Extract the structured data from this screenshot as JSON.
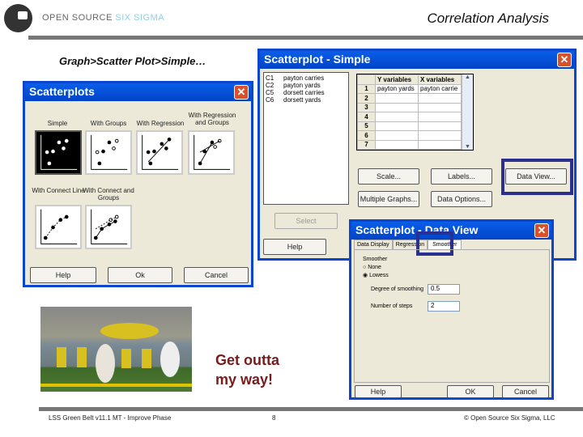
{
  "header": {
    "brand_main": "OPEN SOURCE",
    "brand_accent": "SIX SIGMA",
    "title": "Correlation Analysis",
    "menu_path": "Graph>Scatter Plot>Simple…"
  },
  "scatterplots_dialog": {
    "title": "Scatterplots",
    "options": [
      "Simple",
      "With Groups",
      "With Regression",
      "With Regression and Groups",
      "With Connect Line",
      "With Connect and Groups"
    ],
    "buttons": {
      "help": "Help",
      "ok": "Ok",
      "cancel": "Cancel"
    },
    "selected": "Simple"
  },
  "simple_dialog": {
    "title": "Scatterplot - Simple",
    "columns": [
      {
        "id": "C1",
        "name": "payton carries"
      },
      {
        "id": "C2",
        "name": "payton yards"
      },
      {
        "id": "C5",
        "name": "dorsett carries"
      },
      {
        "id": "C6",
        "name": "dorsett yards"
      }
    ],
    "grid_headers": [
      "Y variables",
      "X variables"
    ],
    "rows": [
      {
        "n": "1",
        "y": "payton yards",
        "x": "payton carrie"
      },
      {
        "n": "2",
        "y": "",
        "x": ""
      },
      {
        "n": "3",
        "y": "",
        "x": ""
      },
      {
        "n": "4",
        "y": "",
        "x": ""
      },
      {
        "n": "5",
        "y": "",
        "x": ""
      },
      {
        "n": "6",
        "y": "",
        "x": ""
      },
      {
        "n": "7",
        "y": "",
        "x": ""
      }
    ],
    "buttons": {
      "scale": "Scale...",
      "labels": "Labels...",
      "data_view": "Data View...",
      "multiple_graphs": "Multiple Graphs...",
      "data_options": "Data Options...",
      "select": "Select",
      "help": "Help"
    }
  },
  "data_view_dialog": {
    "title": "Scatterplot - Data View",
    "tabs": [
      "Data Display",
      "Regression",
      "Smoother"
    ],
    "active_tab": "Smoother",
    "group_label": "Smoother",
    "radios": [
      {
        "label": "None",
        "checked": false
      },
      {
        "label": "Lowess",
        "checked": true
      }
    ],
    "fields": [
      {
        "label": "Degree of smoothing",
        "value": "0.5"
      },
      {
        "label": "Number of steps",
        "value": "2"
      }
    ],
    "buttons": {
      "help": "Help",
      "ok": "OK",
      "cancel": "Cancel"
    }
  },
  "callout": {
    "line1": "Get outta",
    "line2": "my way!"
  },
  "footer": {
    "left": "LSS Green Belt v11.1 MT - Improve Phase",
    "page": "8",
    "right": "© Open Source Six Sigma, LLC"
  },
  "colors": {
    "highlight": "#2b2f8f",
    "quote": "#7b1a1a",
    "titlebar": "#0a5ee8"
  }
}
